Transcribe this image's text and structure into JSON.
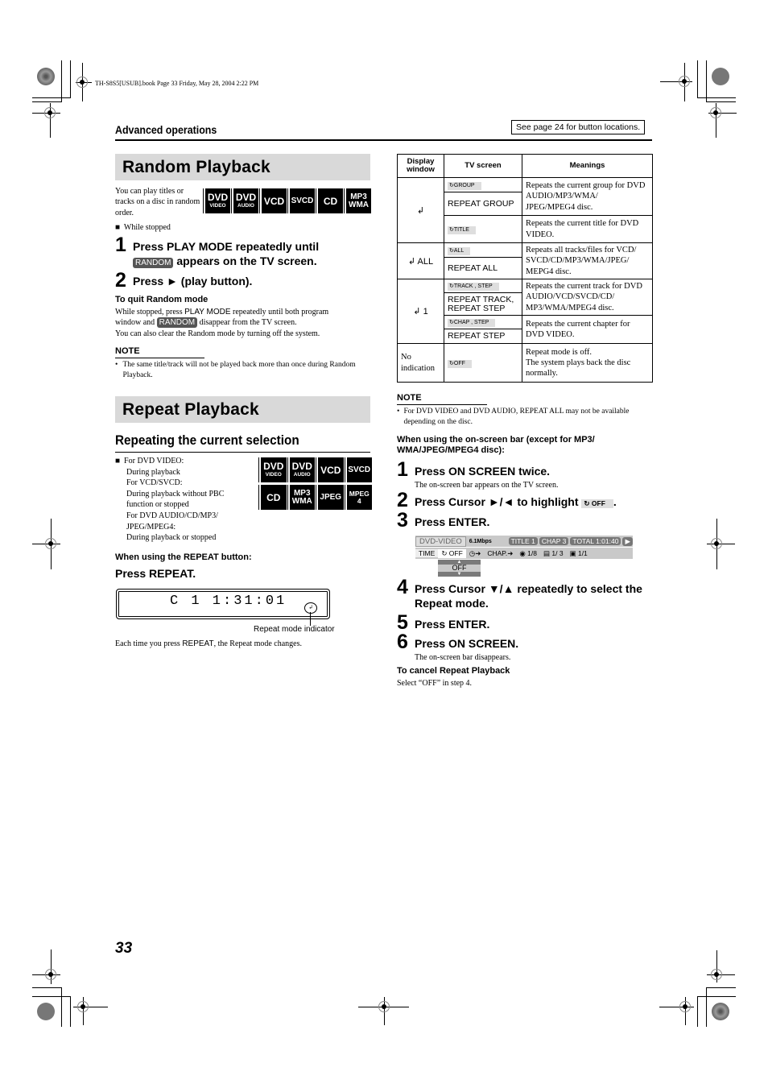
{
  "slug": "TH-S8S5[USUB].book  Page 33  Friday, May 28, 2004  2:22 PM",
  "header": {
    "section": "Advanced operations",
    "see_page": "See page 24 for button locations."
  },
  "random": {
    "title": "Random Playback",
    "intro": "You can play titles or tracks on a disc in random order.",
    "badges": [
      {
        "big": "DVD",
        "small": "VIDEO"
      },
      {
        "big": "DVD",
        "small": "AUDIO"
      },
      {
        "big": "VCD",
        "small": ""
      },
      {
        "big": "SVCD",
        "small": ""
      },
      {
        "big": "CD",
        "small": ""
      },
      {
        "big": "MP3",
        "small": "WMA"
      }
    ],
    "condition": "While stopped",
    "step1_num": "1",
    "step1_a": "Press PLAY MODE repeatedly until",
    "step1_tag": "RANDOM",
    "step1_b": "appears on the TV screen.",
    "step2_num": "2",
    "step2": "Press ► (play button).",
    "quit_title": "To quit Random mode",
    "quit_1a": "While stopped, press ",
    "quit_1key": "PLAY MODE",
    "quit_1b": " repeatedly until both program",
    "quit_2a": "window and ",
    "quit_2tag": "RANDOM",
    "quit_2b": " disappear from the TV screen.",
    "quit_3": "You can also clear the Random mode by turning off the system.",
    "note_title": "NOTE",
    "note_text": "The same title/track will not be played back more than once during Random Playback."
  },
  "repeat": {
    "title": "Repeat Playback",
    "subheading": "Repeating the current selection",
    "conditions": [
      "For DVD VIDEO:",
      "During playback",
      "For VCD/SVCD:",
      "During playback without PBC",
      "function or stopped",
      "For DVD AUDIO/CD/MP3/",
      "JPEG/MPEG4:",
      "During playback or stopped"
    ],
    "badges": [
      {
        "big": "DVD",
        "small": "VIDEO"
      },
      {
        "big": "DVD",
        "small": "AUDIO"
      },
      {
        "big": "VCD",
        "small": ""
      },
      {
        "big": "SVCD",
        "small": ""
      },
      {
        "big": "CD",
        "small": ""
      },
      {
        "big": "MP3",
        "small": "WMA"
      },
      {
        "big": "JPEG",
        "small": ""
      },
      {
        "big": "MPEG",
        "small": "4"
      }
    ],
    "button_title": "When using the REPEAT button:",
    "press_repeat": "Press REPEAT.",
    "lcd_text": "C 1  1:31:01",
    "indicator_label": "Repeat mode indicator",
    "each_time_a": "Each time you press ",
    "each_time_key": "REPEAT",
    "each_time_b": ", the Repeat mode changes."
  },
  "table": {
    "headers": [
      "Display window",
      "TV screen",
      "Meanings"
    ],
    "rows": [
      {
        "display": "↲",
        "tv_chip": "GROUP",
        "tv_text": "REPEAT GROUP",
        "meaning": "Repeats the current group for DVD AUDIO/MP3/WMA/ JPEG/MPEG4 disc."
      },
      {
        "display": "",
        "tv_chip": "TITLE",
        "tv_text": "",
        "meaning": "Repeats the current title for DVD VIDEO."
      },
      {
        "display": "↲ ALL",
        "tv_chip": "ALL",
        "tv_text": "REPEAT ALL",
        "meaning": "Repeats all tracks/files for VCD/ SVCD/CD/MP3/WMA/JPEG/ MEPG4 disc."
      },
      {
        "display": "↲ 1",
        "tv_chip": "TRACK , STEP",
        "tv_text": "REPEAT TRACK, REPEAT STEP",
        "meaning": "Repeats the current track for DVD AUDIO/VCD/SVCD/CD/ MP3/WMA/MPEG4 disc."
      },
      {
        "display": "",
        "tv_chip": "CHAP , STEP",
        "tv_text": "REPEAT STEP",
        "meaning": "Repeats the current chapter for DVD VIDEO."
      },
      {
        "display": "No indication",
        "tv_chip": "OFF",
        "tv_text": "",
        "meaning_1": "Repeat mode is off.",
        "meaning_2": "The system plays back the disc normally."
      }
    ]
  },
  "right": {
    "note_title": "NOTE",
    "note_text": "For DVD VIDEO and DVD AUDIO, REPEAT ALL may not be available depending on the disc.",
    "onscreen_title": "When using the on-screen bar (except for MP3/ WMA/JPEG/MPEG4 disc):",
    "steps": [
      {
        "num": "1",
        "text": "Press ON SCREEN twice.",
        "sub": "The on-screen bar appears on the TV screen."
      },
      {
        "num": "2",
        "text": "Press Cursor ►/◄ to highlight",
        "chip": "OFF",
        "tail": "."
      },
      {
        "num": "3",
        "text": "Press ENTER."
      },
      {
        "num": "4",
        "text": "Press Cursor ▼/▲ repeatedly to select the Repeat mode."
      },
      {
        "num": "5",
        "text": "Press ENTER."
      },
      {
        "num": "6",
        "text": "Press ON SCREEN.",
        "sub": "The on-screen bar disappears."
      }
    ],
    "osd": {
      "disc": "DVD-VIDEO",
      "rate": "6.1Mbps",
      "title_label": "TITLE",
      "title_val": "1",
      "chap_label": "CHAP",
      "chap_val": "3",
      "total_label": "TOTAL",
      "total_val": "1:01:40",
      "time": "TIME",
      "repeat": "OFF",
      "chap_arrow": "CHAP.",
      "audio": "1/8",
      "subtitle": "1/ 3",
      "angle": "1/1",
      "dropdown": "OFF"
    },
    "cancel_title": "To cancel Repeat Playback",
    "cancel_text": "Select “OFF” in step 4."
  },
  "page_number": "33"
}
